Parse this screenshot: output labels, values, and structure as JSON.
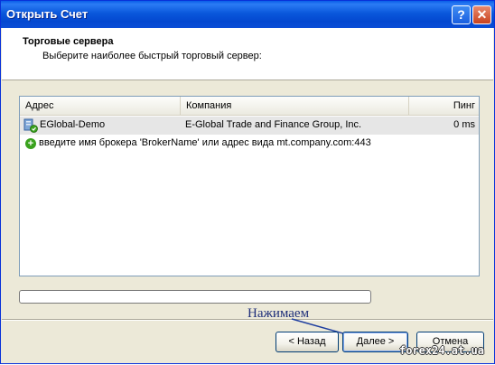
{
  "window": {
    "title": "Открыть Счет",
    "help_glyph": "?",
    "close_glyph": "✕"
  },
  "header": {
    "title": "Торговые сервера",
    "subtitle": "Выберите наиболее быстрый торговый сервер:"
  },
  "server_list": {
    "columns": [
      "Адрес",
      "Компания",
      "Пинг"
    ],
    "rows": [
      {
        "address": "EGlobal-Demo",
        "company": "E-Global Trade and Finance Group, Inc.",
        "ping": "0 ms",
        "icon": "server-icon",
        "selected": true
      }
    ],
    "add_hint": "введите имя брокера 'BrokerName' или адрес вида mt.company.com:443",
    "add_icon": "plus-circle-icon"
  },
  "progress": {
    "value": 0
  },
  "buttons": {
    "back": "< Назад",
    "next": "Далее >",
    "cancel": "Отмена"
  },
  "annotation": "Нажимаем",
  "watermark": "forex24.at.ua",
  "colors": {
    "titlebar": "#0a58dc",
    "dialog_bg": "#ece9d8",
    "annotation": "#1f2f7a",
    "add_icon": "#3aa21e"
  }
}
